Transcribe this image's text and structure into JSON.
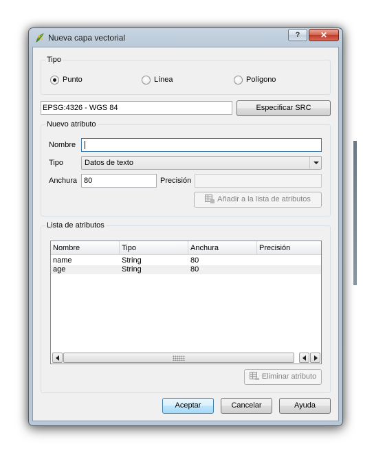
{
  "window": {
    "title": "Nueva capa vectorial",
    "help_glyph": "?",
    "close_glyph": "✕",
    "icon": "qgis-logo-icon"
  },
  "tipo_group": {
    "legend": "Tipo",
    "options": [
      {
        "label": "Punto",
        "selected": true
      },
      {
        "label": "Línea",
        "selected": false
      },
      {
        "label": "Polígono",
        "selected": false
      }
    ]
  },
  "crs": {
    "value": "EPSG:4326 - WGS 84",
    "button_label": "Especificar SRC"
  },
  "new_attribute": {
    "legend": "Nuevo atributo",
    "name_label": "Nombre",
    "name_value": "",
    "type_label": "Tipo",
    "type_value": "Datos de texto",
    "width_label": "Anchura",
    "width_value": "80",
    "precision_label": "Precisión",
    "precision_value": "",
    "add_button_label": "Añadir a la lista de atributos"
  },
  "attribute_list": {
    "legend": "Lista de atributos",
    "columns": [
      "Nombre",
      "Tipo",
      "Anchura",
      "Precisión"
    ],
    "rows": [
      [
        "name",
        "String",
        "80",
        ""
      ],
      [
        "age",
        "String",
        "80",
        ""
      ]
    ],
    "remove_button_label": "Eliminar atributo"
  },
  "footer": {
    "ok_label": "Aceptar",
    "cancel_label": "Cancelar",
    "help_label": "Ayuda"
  },
  "colors": {
    "focus_border": "#3d7bad",
    "default_button_border": "#3c7fb1",
    "close_button": "#c0392b"
  }
}
